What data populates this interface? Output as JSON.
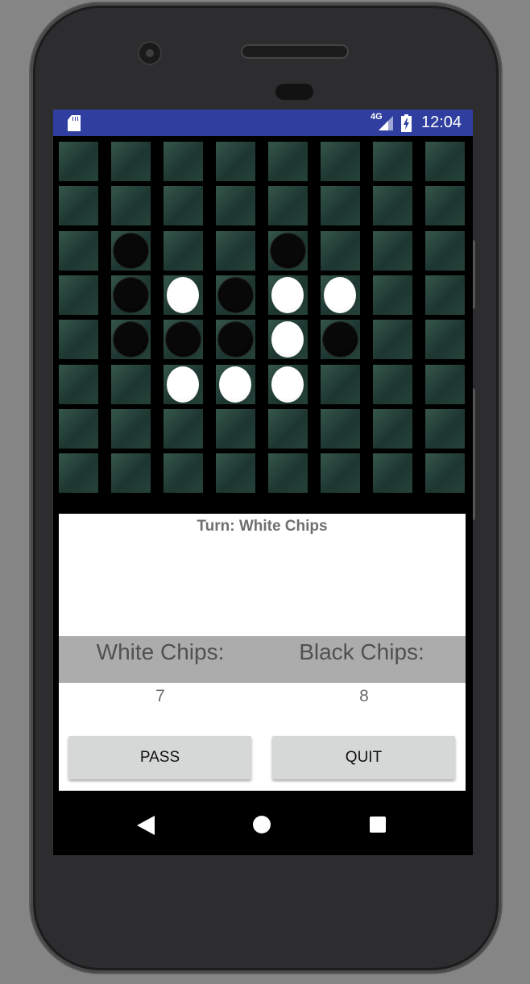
{
  "status_bar": {
    "network": "4G",
    "time": "12:04",
    "icons": [
      "sd-card-icon",
      "signal-icon",
      "battery-charging-icon"
    ],
    "background_color": "#303f9f"
  },
  "board": {
    "rows": 8,
    "cols": 8,
    "cells": [
      [
        0,
        0,
        0,
        0,
        0,
        0,
        0,
        0
      ],
      [
        0,
        0,
        0,
        0,
        0,
        0,
        0,
        0
      ],
      [
        0,
        2,
        0,
        0,
        2,
        0,
        0,
        0
      ],
      [
        0,
        2,
        1,
        2,
        1,
        1,
        0,
        0
      ],
      [
        0,
        2,
        2,
        2,
        1,
        2,
        0,
        0
      ],
      [
        0,
        0,
        1,
        1,
        1,
        0,
        0,
        0
      ],
      [
        0,
        0,
        0,
        0,
        0,
        0,
        0,
        0
      ],
      [
        0,
        0,
        0,
        0,
        0,
        0,
        0,
        0
      ]
    ],
    "legend": {
      "0": "empty",
      "1": "white",
      "2": "black"
    }
  },
  "game": {
    "turn_text": "Turn: White Chips",
    "white_label": "White Chips:",
    "black_label": "Black Chips:",
    "white_count": "7",
    "black_count": "8"
  },
  "buttons": {
    "pass_label": "PASS",
    "quit_label": "QUIT"
  },
  "nav": {
    "icons": [
      "back-icon",
      "home-icon",
      "recent-apps-icon"
    ]
  }
}
